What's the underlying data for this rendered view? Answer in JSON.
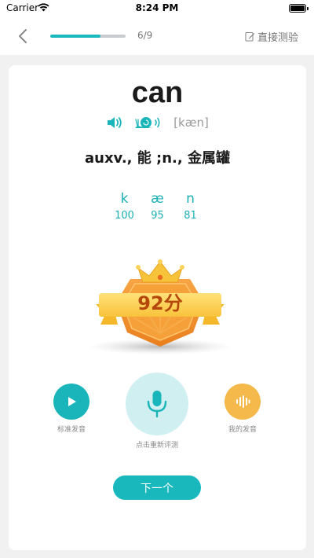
{
  "status_bar": {
    "carrier": "Carrier",
    "time": "8:24 PM"
  },
  "nav": {
    "progress_fraction": 0.67,
    "progress_text": "6/9",
    "skip_label": "直接测验"
  },
  "word": {
    "text": "can",
    "phonetic": "[kæn]",
    "meaning": "auxv., 能 ;n., 金属罐"
  },
  "phonemes": [
    {
      "symbol": "k",
      "score": "100"
    },
    {
      "symbol": "æ",
      "score": "95"
    },
    {
      "symbol": "n",
      "score": "81"
    }
  ],
  "result": {
    "score_label": "92分"
  },
  "controls": {
    "standard_label": "标准发音",
    "record_label": "点击重新评测",
    "mine_label": "我的发音"
  },
  "next_label": "下一个",
  "colors": {
    "accent": "#19b8bd",
    "badge_orange": "#f5a623",
    "score_text": "#b5480b"
  }
}
